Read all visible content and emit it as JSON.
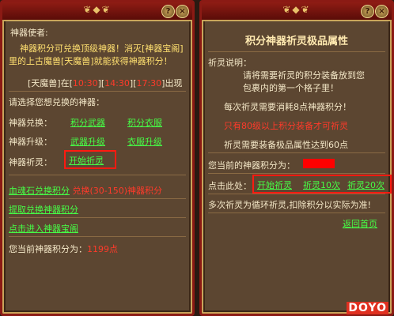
{
  "left": {
    "title": "神器使者:",
    "intro1": "神器积分可兑换顶级神器！消灭[神器宝阁]",
    "intro2": "里的上古魔兽[天魔兽]就能获得神器积分！",
    "schedule_prefix": "[天魔兽]在[",
    "time1": "10:30",
    "sep1": "][",
    "time2": "14:30",
    "sep2": "][",
    "time3": "17:30",
    "schedule_suffix": "]出现",
    "choose_prompt": "请选择您想兑换的神器：",
    "exchange_label": "神器兑换：",
    "exchange_weapon": "积分武器",
    "exchange_clothes": "积分衣服",
    "upgrade_label": "神器升级：",
    "upgrade_weapon": "武器升级",
    "upgrade_clothes": "衣服升级",
    "pray_label": "神器祈灵：",
    "pray_start": "开始祈灵",
    "stone_link": "血魂石兑换积分",
    "stone_text": "兑换(30-150)神器积分",
    "withdraw_link": "提取兑换神器积分",
    "enter_link": "点击进入神器宝阁",
    "points_prefix": "您当前神器积分为：",
    "points_value": "1199点"
  },
  "right": {
    "title": "积分神器祈灵极品属性",
    "desc_label": "祈灵说明：",
    "desc1": "请将需要祈灵的积分装备放到您",
    "desc2": "包裹内的第一个格子里！",
    "cost_text": "每次祈灵需要消耗8点神器积分！",
    "req_level": "只有80级以上积分装备才可祈灵",
    "req_stats": "祈灵需要装备极品属性达到60点",
    "points_prefix": "您当前的神器积分为：",
    "click_label": "点击此处：",
    "btn_start": "开始祈灵",
    "btn_10": "祈灵10次",
    "btn_20": "祈灵20次",
    "multi_note": "多次祈灵为循环祈灵,扣除积分以实际为准!",
    "back_home": "返回首页"
  },
  "buttons": {
    "help": "?",
    "close": "×"
  },
  "watermark": {
    "letters": "DOYO"
  },
  "colors": {
    "link": "#46ff46",
    "alert": "#ff3a2a",
    "highlight": "#ff1a10",
    "panel": "#5c4631"
  }
}
